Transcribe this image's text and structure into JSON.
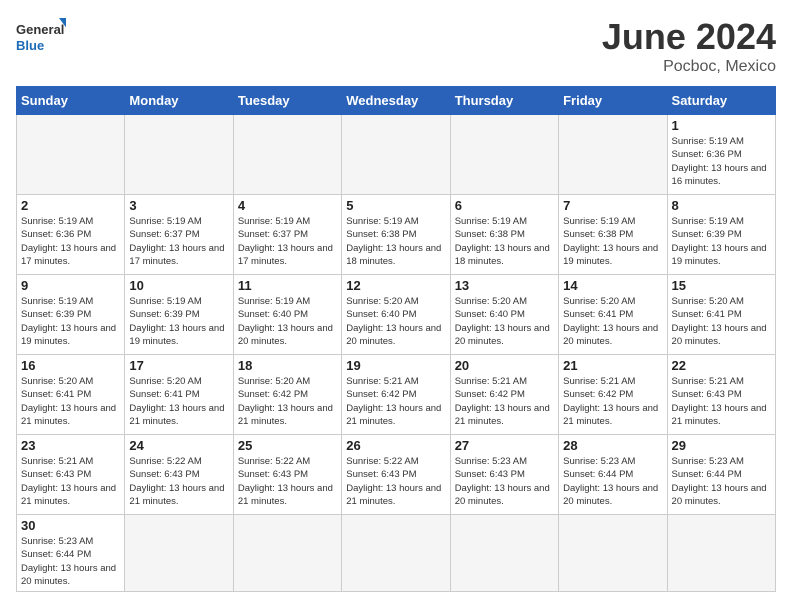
{
  "header": {
    "logo_general": "General",
    "logo_blue": "Blue",
    "month_title": "June 2024",
    "location": "Pocboc, Mexico"
  },
  "weekdays": [
    "Sunday",
    "Monday",
    "Tuesday",
    "Wednesday",
    "Thursday",
    "Friday",
    "Saturday"
  ],
  "weeks": [
    [
      {
        "day": "",
        "empty": true
      },
      {
        "day": "",
        "empty": true
      },
      {
        "day": "",
        "empty": true
      },
      {
        "day": "",
        "empty": true
      },
      {
        "day": "",
        "empty": true
      },
      {
        "day": "",
        "empty": true
      },
      {
        "day": "1",
        "sunrise": "Sunrise: 5:19 AM",
        "sunset": "Sunset: 6:36 PM",
        "daylight": "Daylight: 13 hours and 16 minutes."
      }
    ],
    [
      {
        "day": "2",
        "sunrise": "Sunrise: 5:19 AM",
        "sunset": "Sunset: 6:36 PM",
        "daylight": "Daylight: 13 hours and 17 minutes."
      },
      {
        "day": "3",
        "sunrise": "Sunrise: 5:19 AM",
        "sunset": "Sunset: 6:37 PM",
        "daylight": "Daylight: 13 hours and 17 minutes."
      },
      {
        "day": "4",
        "sunrise": "Sunrise: 5:19 AM",
        "sunset": "Sunset: 6:37 PM",
        "daylight": "Daylight: 13 hours and 17 minutes."
      },
      {
        "day": "5",
        "sunrise": "Sunrise: 5:19 AM",
        "sunset": "Sunset: 6:38 PM",
        "daylight": "Daylight: 13 hours and 18 minutes."
      },
      {
        "day": "6",
        "sunrise": "Sunrise: 5:19 AM",
        "sunset": "Sunset: 6:38 PM",
        "daylight": "Daylight: 13 hours and 18 minutes."
      },
      {
        "day": "7",
        "sunrise": "Sunrise: 5:19 AM",
        "sunset": "Sunset: 6:38 PM",
        "daylight": "Daylight: 13 hours and 19 minutes."
      },
      {
        "day": "8",
        "sunrise": "Sunrise: 5:19 AM",
        "sunset": "Sunset: 6:39 PM",
        "daylight": "Daylight: 13 hours and 19 minutes."
      }
    ],
    [
      {
        "day": "9",
        "sunrise": "Sunrise: 5:19 AM",
        "sunset": "Sunset: 6:39 PM",
        "daylight": "Daylight: 13 hours and 19 minutes."
      },
      {
        "day": "10",
        "sunrise": "Sunrise: 5:19 AM",
        "sunset": "Sunset: 6:39 PM",
        "daylight": "Daylight: 13 hours and 19 minutes."
      },
      {
        "day": "11",
        "sunrise": "Sunrise: 5:19 AM",
        "sunset": "Sunset: 6:40 PM",
        "daylight": "Daylight: 13 hours and 20 minutes."
      },
      {
        "day": "12",
        "sunrise": "Sunrise: 5:20 AM",
        "sunset": "Sunset: 6:40 PM",
        "daylight": "Daylight: 13 hours and 20 minutes."
      },
      {
        "day": "13",
        "sunrise": "Sunrise: 5:20 AM",
        "sunset": "Sunset: 6:40 PM",
        "daylight": "Daylight: 13 hours and 20 minutes."
      },
      {
        "day": "14",
        "sunrise": "Sunrise: 5:20 AM",
        "sunset": "Sunset: 6:41 PM",
        "daylight": "Daylight: 13 hours and 20 minutes."
      },
      {
        "day": "15",
        "sunrise": "Sunrise: 5:20 AM",
        "sunset": "Sunset: 6:41 PM",
        "daylight": "Daylight: 13 hours and 20 minutes."
      }
    ],
    [
      {
        "day": "16",
        "sunrise": "Sunrise: 5:20 AM",
        "sunset": "Sunset: 6:41 PM",
        "daylight": "Daylight: 13 hours and 21 minutes."
      },
      {
        "day": "17",
        "sunrise": "Sunrise: 5:20 AM",
        "sunset": "Sunset: 6:41 PM",
        "daylight": "Daylight: 13 hours and 21 minutes."
      },
      {
        "day": "18",
        "sunrise": "Sunrise: 5:20 AM",
        "sunset": "Sunset: 6:42 PM",
        "daylight": "Daylight: 13 hours and 21 minutes."
      },
      {
        "day": "19",
        "sunrise": "Sunrise: 5:21 AM",
        "sunset": "Sunset: 6:42 PM",
        "daylight": "Daylight: 13 hours and 21 minutes."
      },
      {
        "day": "20",
        "sunrise": "Sunrise: 5:21 AM",
        "sunset": "Sunset: 6:42 PM",
        "daylight": "Daylight: 13 hours and 21 minutes."
      },
      {
        "day": "21",
        "sunrise": "Sunrise: 5:21 AM",
        "sunset": "Sunset: 6:42 PM",
        "daylight": "Daylight: 13 hours and 21 minutes."
      },
      {
        "day": "22",
        "sunrise": "Sunrise: 5:21 AM",
        "sunset": "Sunset: 6:43 PM",
        "daylight": "Daylight: 13 hours and 21 minutes."
      }
    ],
    [
      {
        "day": "23",
        "sunrise": "Sunrise: 5:21 AM",
        "sunset": "Sunset: 6:43 PM",
        "daylight": "Daylight: 13 hours and 21 minutes."
      },
      {
        "day": "24",
        "sunrise": "Sunrise: 5:22 AM",
        "sunset": "Sunset: 6:43 PM",
        "daylight": "Daylight: 13 hours and 21 minutes."
      },
      {
        "day": "25",
        "sunrise": "Sunrise: 5:22 AM",
        "sunset": "Sunset: 6:43 PM",
        "daylight": "Daylight: 13 hours and 21 minutes."
      },
      {
        "day": "26",
        "sunrise": "Sunrise: 5:22 AM",
        "sunset": "Sunset: 6:43 PM",
        "daylight": "Daylight: 13 hours and 21 minutes."
      },
      {
        "day": "27",
        "sunrise": "Sunrise: 5:23 AM",
        "sunset": "Sunset: 6:43 PM",
        "daylight": "Daylight: 13 hours and 20 minutes."
      },
      {
        "day": "28",
        "sunrise": "Sunrise: 5:23 AM",
        "sunset": "Sunset: 6:44 PM",
        "daylight": "Daylight: 13 hours and 20 minutes."
      },
      {
        "day": "29",
        "sunrise": "Sunrise: 5:23 AM",
        "sunset": "Sunset: 6:44 PM",
        "daylight": "Daylight: 13 hours and 20 minutes."
      }
    ],
    [
      {
        "day": "30",
        "sunrise": "Sunrise: 5:23 AM",
        "sunset": "Sunset: 6:44 PM",
        "daylight": "Daylight: 13 hours and 20 minutes."
      },
      {
        "day": "",
        "empty": true
      },
      {
        "day": "",
        "empty": true
      },
      {
        "day": "",
        "empty": true
      },
      {
        "day": "",
        "empty": true
      },
      {
        "day": "",
        "empty": true
      },
      {
        "day": "",
        "empty": true
      }
    ]
  ]
}
